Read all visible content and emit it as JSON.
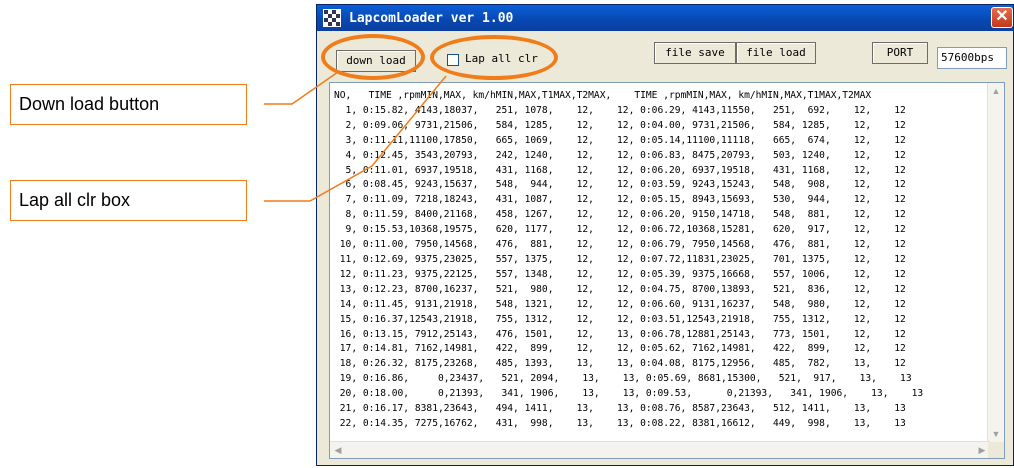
{
  "window": {
    "title": "LapcomLoader ver 1.00",
    "close_glyph": "✕",
    "icon": "checkered-flag-icon"
  },
  "toolbar": {
    "download_label": "down load",
    "lap_all_clr_label": "Lap all clr",
    "lap_all_clr_checked": false,
    "file_save_label": "file save",
    "file_load_label": "file load",
    "port_label": "PORT",
    "port_value": "57600bps"
  },
  "log": {
    "header": "NO,   TIME ,rpmMIN,MAX, km/hMIN,MAX,T1MAX,T2MAX,    TIME ,rpmMIN,MAX, km/hMIN,MAX,T1MAX,T2MAX",
    "rows": [
      "  1, 0:15.82, 4143,18037,   251, 1078,    12,    12, 0:06.29, 4143,11550,   251,  692,    12,    12",
      "  2, 0:09.06, 9731,21506,   584, 1285,    12,    12, 0:04.00, 9731,21506,   584, 1285,    12,    12",
      "  3, 0:11.11,11100,17850,   665, 1069,    12,    12, 0:05.14,11100,11118,   665,  674,    12,    12",
      "  4, 0:12.45, 3543,20793,   242, 1240,    12,    12, 0:06.83, 8475,20793,   503, 1240,    12,    12",
      "  5, 0:11.01, 6937,19518,   431, 1168,    12,    12, 0:06.20, 6937,19518,   431, 1168,    12,    12",
      "  6, 0:08.45, 9243,15637,   548,  944,    12,    12, 0:03.59, 9243,15243,   548,  908,    12,    12",
      "  7, 0:11.09, 7218,18243,   431, 1087,    12,    12, 0:05.15, 8943,15693,   530,  944,    12,    12",
      "  8, 0:11.59, 8400,21168,   458, 1267,    12,    12, 0:06.20, 9150,14718,   548,  881,    12,    12",
      "  9, 0:15.53,10368,19575,   620, 1177,    12,    12, 0:06.72,10368,15281,   620,  917,    12,    12",
      " 10, 0:11.00, 7950,14568,   476,  881,    12,    12, 0:06.79, 7950,14568,   476,  881,    12,    12",
      " 11, 0:12.69, 9375,23025,   557, 1375,    12,    12, 0:07.72,11831,23025,   701, 1375,    12,    12",
      " 12, 0:11.23, 9375,22125,   557, 1348,    12,    12, 0:05.39, 9375,16668,   557, 1006,    12,    12",
      " 13, 0:12.23, 8700,16237,   521,  980,    12,    12, 0:04.75, 8700,13893,   521,  836,    12,    12",
      " 14, 0:11.45, 9131,21918,   548, 1321,    12,    12, 0:06.60, 9131,16237,   548,  980,    12,    12",
      " 15, 0:16.37,12543,21918,   755, 1312,    12,    12, 0:03.51,12543,21918,   755, 1312,    12,    12",
      " 16, 0:13.15, 7912,25143,   476, 1501,    12,    13, 0:06.78,12881,25143,   773, 1501,    12,    12",
      " 17, 0:14.81, 7162,14981,   422,  899,    12,    12, 0:05.62, 7162,14981,   422,  899,    12,    12",
      " 18, 0:26.32, 8175,23268,   485, 1393,    13,    13, 0:04.08, 8175,12956,   485,  782,    13,    12",
      " 19, 0:16.86,     0,23437,   521, 2094,    13,    13, 0:05.69, 8681,15300,   521,  917,    13,    13",
      " 20, 0:18.00,     0,21393,   341, 1906,    13,    13, 0:09.53,      0,21393,   341, 1906,    13,    13",
      " 21, 0:16.17, 8381,23643,   494, 1411,    13,    13, 0:08.76, 8587,23643,   512, 1411,    13,    13",
      " 22, 0:14.35, 7275,16762,   431,  998,    13,    13, 0:08.22, 8381,16612,   449,  998,    13,    13"
    ]
  },
  "annotations": {
    "download_callout": "Down load button",
    "lap_callout": "Lap all clr box",
    "accent_color": "#f07c1a"
  }
}
